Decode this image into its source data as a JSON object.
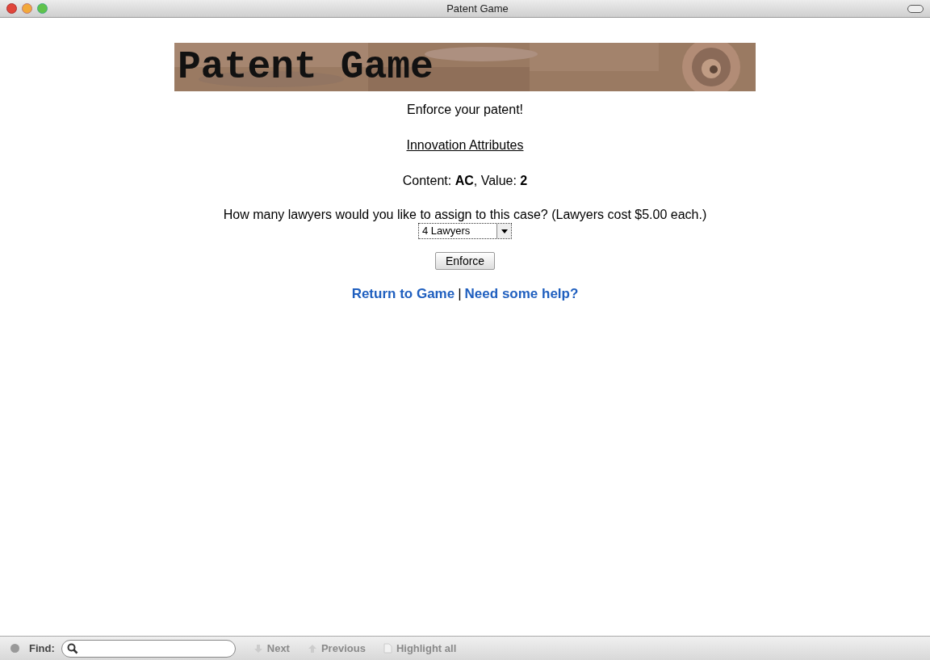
{
  "window": {
    "title": "Patent Game"
  },
  "banner": {
    "title": "Patent Game"
  },
  "heading": "Enforce your patent!",
  "attributes_link": "Innovation Attributes",
  "attributes": "Content: **AC**, Value: **2**",
  "question": "How many lawyers would you like to assign to this case? (Lawyers cost $5.00 each.)",
  "lawyers_select": {
    "value": "4 Lawyers"
  },
  "enforce_button": "Enforce",
  "links": [
    {
      "label": "Return to Game"
    },
    {
      "label": "Need some help?"
    }
  ],
  "link_separator": "|",
  "find_bar": {
    "label": "Find:",
    "buttons": [
      {
        "label": "Next",
        "kind": "next",
        "disabled": true
      },
      {
        "label": "Previous",
        "kind": "previous",
        "disabled": true
      },
      {
        "label": "Highlight all",
        "kind": "highlight",
        "disabled": true
      }
    ]
  }
}
